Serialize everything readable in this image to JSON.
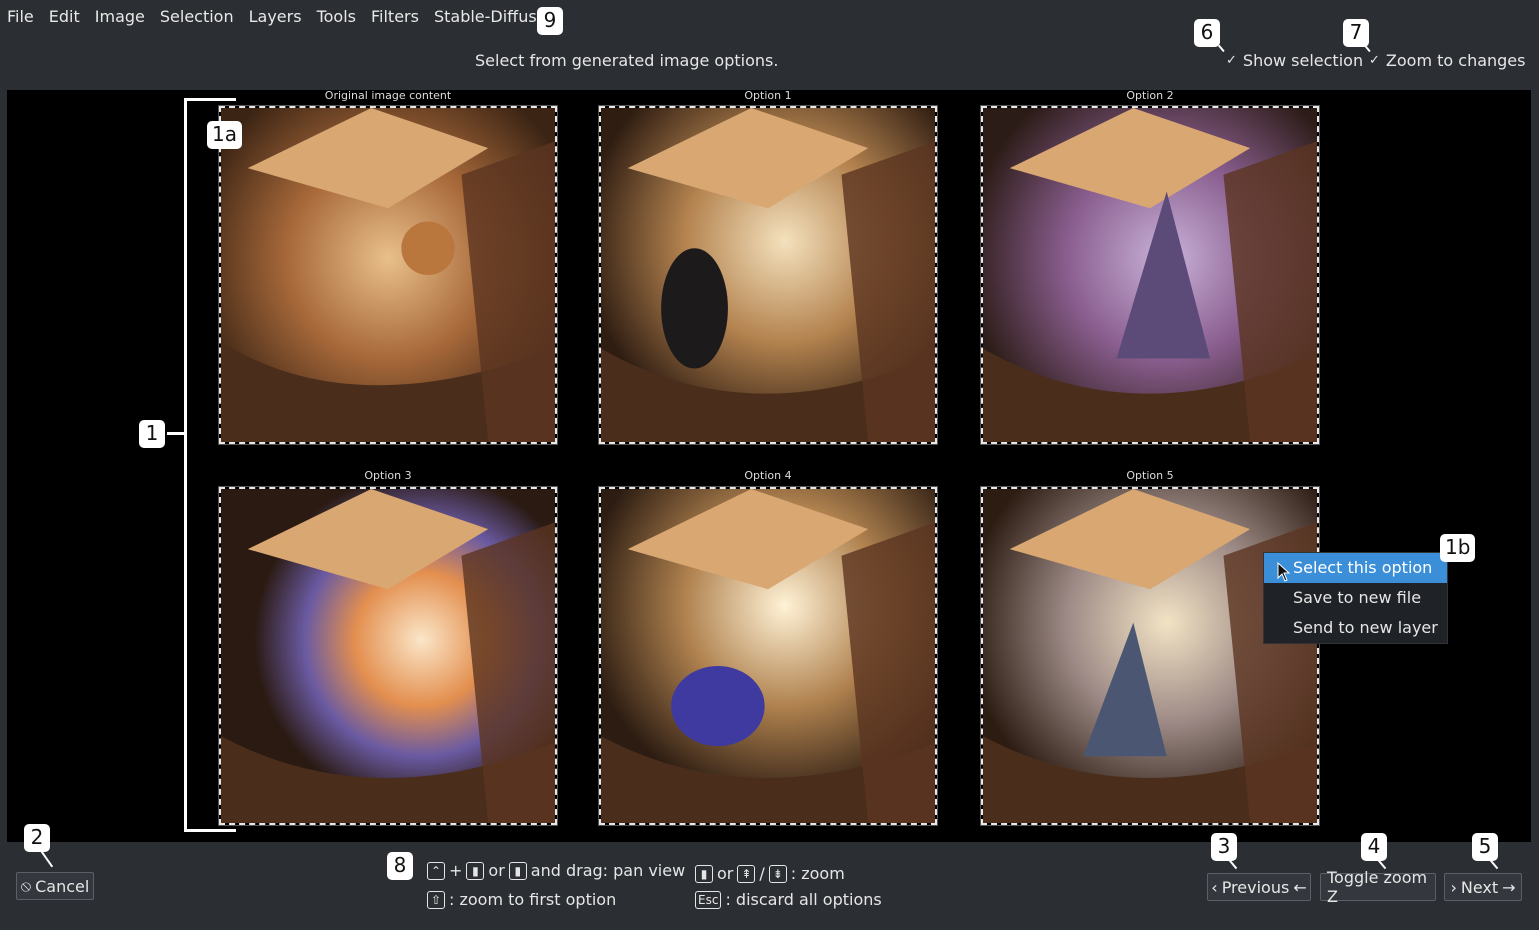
{
  "menubar": [
    "File",
    "Edit",
    "Image",
    "Selection",
    "Layers",
    "Tools",
    "Filters",
    "Stable-Diffusion"
  ],
  "instruction": "Select from generated image options.",
  "checkboxes": {
    "show_selection": "Show selection",
    "zoom_to_changes": "Zoom to changes"
  },
  "tiles": [
    {
      "label": "Original image content",
      "icon": "original-image"
    },
    {
      "label": "Option 1",
      "icon": "generated-image"
    },
    {
      "label": "Option 2",
      "icon": "generated-image"
    },
    {
      "label": "Option 3",
      "icon": "generated-image"
    },
    {
      "label": "Option 4",
      "icon": "generated-image"
    },
    {
      "label": "Option 5",
      "icon": "generated-image"
    }
  ],
  "context_menu": [
    "Select this option",
    "Save to new file",
    "Send to new layer"
  ],
  "callouts": {
    "c1": "1",
    "c1a": "1a",
    "c1b": "1b",
    "c2": "2",
    "c3": "3",
    "c4": "4",
    "c5": "5",
    "c6": "6",
    "c7": "7",
    "c8": "8",
    "c9": "9"
  },
  "buttons": {
    "cancel": "Cancel",
    "previous": "Previous",
    "toggle_zoom": "Toggle zoom Z",
    "next": "Next"
  },
  "hints": {
    "pan_or": "or",
    "pan": "and drag: pan view",
    "zoom_first": ": zoom to first option",
    "zoom_or": "or",
    "zoom_slash": "/",
    "zoom": ": zoom",
    "esc_key": "Esc",
    "discard": ": discard all options"
  },
  "colors": {
    "menu_bg": "#2b2e33",
    "canvas_bg": "#000000",
    "highlight": "#3a8fd8"
  }
}
